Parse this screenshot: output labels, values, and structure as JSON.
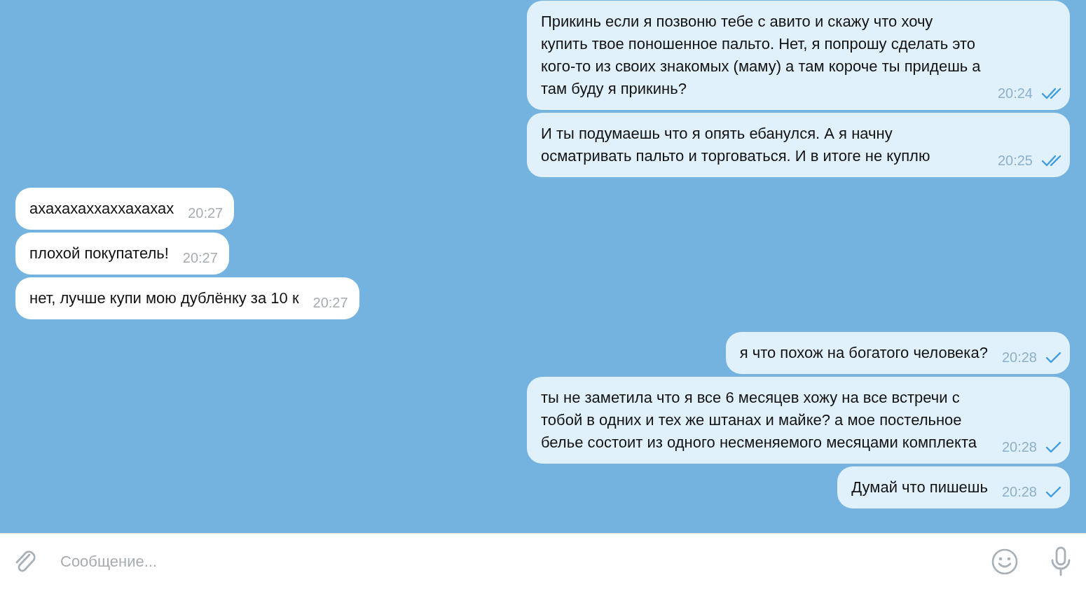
{
  "messages": [
    {
      "kind": "out",
      "text": "Прикинь если я позвоню тебе с авито и скажу что хочу купить твое поношенное пальто. Нет, я попрошу сделать это кого-то из своих знакомых (маму) а там короче ты придешь а там буду я прикинь?",
      "time": "20:24",
      "read": true
    },
    {
      "kind": "out",
      "text": "И ты подумаешь что я опять ебанулся. А я начну осматривать пальто и торговаться. И в итоге не куплю",
      "time": "20:25",
      "read": true
    },
    {
      "kind": "in",
      "text": "ахахахаххаххахахах",
      "time": "20:27"
    },
    {
      "kind": "in",
      "text": "плохой покупатель!",
      "time": "20:27"
    },
    {
      "kind": "in",
      "text": "нет, лучше купи мою дублёнку за 10 к",
      "time": "20:27"
    },
    {
      "kind": "out",
      "text": "я что похож на богатого человека?",
      "time": "20:28",
      "read": false
    },
    {
      "kind": "out",
      "text": "ты не заметила что я все 6 месяцев хожу на все встречи с тобой в одних и тех же штанах и майке? а мое постельное белье состоит из одного несменяемого месяцами комплекта",
      "time": "20:28",
      "read": false
    },
    {
      "kind": "out",
      "text": "Думай что пишешь",
      "time": "20:28",
      "read": false
    }
  ],
  "composer": {
    "placeholder": "Сообщение..."
  }
}
